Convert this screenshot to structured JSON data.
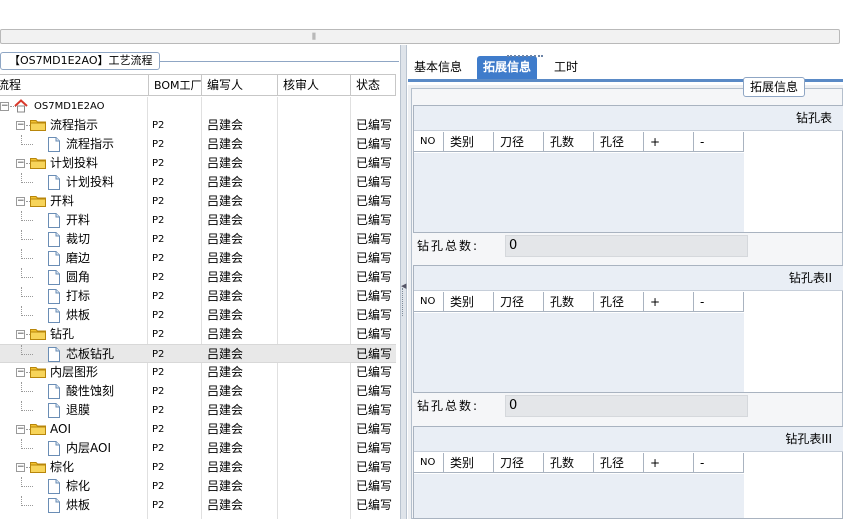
{
  "topbar": {
    "scroll_grip": "⫼"
  },
  "left_panel": {
    "group_title": "【OS7MD1E2AO】工艺流程",
    "columns": [
      "流程",
      "BOM工厂",
      "编写人",
      "核审人",
      "状态"
    ],
    "rows": [
      {
        "name": "OS7MD1E2AO",
        "icon": "home-icon",
        "level": 0,
        "expand": "minus",
        "bom": "",
        "author": "",
        "reviewer": "",
        "status": ""
      },
      {
        "name": "流程指示",
        "icon": "folder-icon",
        "level": 1,
        "expand": "minus",
        "bom": "P2",
        "author": "吕建会",
        "reviewer": "",
        "status": "已编写"
      },
      {
        "name": "流程指示",
        "icon": "document-icon",
        "level": 2,
        "expand": "",
        "bom": "P2",
        "author": "吕建会",
        "reviewer": "",
        "status": "已编写"
      },
      {
        "name": "计划投料",
        "icon": "folder-icon",
        "level": 1,
        "expand": "minus",
        "bom": "P2",
        "author": "吕建会",
        "reviewer": "",
        "status": "已编写"
      },
      {
        "name": "计划投料",
        "icon": "document-icon",
        "level": 2,
        "expand": "",
        "bom": "P2",
        "author": "吕建会",
        "reviewer": "",
        "status": "已编写"
      },
      {
        "name": "开料",
        "icon": "folder-icon",
        "level": 1,
        "expand": "minus",
        "bom": "P2",
        "author": "吕建会",
        "reviewer": "",
        "status": "已编写"
      },
      {
        "name": "开料",
        "icon": "document-icon",
        "level": 2,
        "expand": "",
        "bom": "P2",
        "author": "吕建会",
        "reviewer": "",
        "status": "已编写"
      },
      {
        "name": "裁切",
        "icon": "document-icon",
        "level": 2,
        "expand": "",
        "bom": "P2",
        "author": "吕建会",
        "reviewer": "",
        "status": "已编写"
      },
      {
        "name": "磨边",
        "icon": "document-icon",
        "level": 2,
        "expand": "",
        "bom": "P2",
        "author": "吕建会",
        "reviewer": "",
        "status": "已编写"
      },
      {
        "name": "圆角",
        "icon": "document-icon",
        "level": 2,
        "expand": "",
        "bom": "P2",
        "author": "吕建会",
        "reviewer": "",
        "status": "已编写"
      },
      {
        "name": "打标",
        "icon": "document-icon",
        "level": 2,
        "expand": "",
        "bom": "P2",
        "author": "吕建会",
        "reviewer": "",
        "status": "已编写"
      },
      {
        "name": "烘板",
        "icon": "document-icon",
        "level": 2,
        "expand": "",
        "bom": "P2",
        "author": "吕建会",
        "reviewer": "",
        "status": "已编写"
      },
      {
        "name": "钻孔",
        "icon": "folder-icon",
        "level": 1,
        "expand": "minus",
        "bom": "P2",
        "author": "吕建会",
        "reviewer": "",
        "status": "已编写"
      },
      {
        "name": "芯板钻孔",
        "icon": "document-icon",
        "level": 2,
        "expand": "",
        "bom": "P2",
        "author": "吕建会",
        "reviewer": "",
        "status": "已编写",
        "selected": true
      },
      {
        "name": "内层图形",
        "icon": "folder-icon",
        "level": 1,
        "expand": "minus",
        "bom": "P2",
        "author": "吕建会",
        "reviewer": "",
        "status": "已编写"
      },
      {
        "name": "酸性蚀刻",
        "icon": "document-icon",
        "level": 2,
        "expand": "",
        "bom": "P2",
        "author": "吕建会",
        "reviewer": "",
        "status": "已编写"
      },
      {
        "name": "退膜",
        "icon": "document-icon",
        "level": 2,
        "expand": "",
        "bom": "P2",
        "author": "吕建会",
        "reviewer": "",
        "status": "已编写"
      },
      {
        "name": "AOI",
        "icon": "folder-icon",
        "level": 1,
        "expand": "minus",
        "bom": "P2",
        "author": "吕建会",
        "reviewer": "",
        "status": "已编写"
      },
      {
        "name": "内层AOI",
        "icon": "document-icon",
        "level": 2,
        "expand": "",
        "bom": "P2",
        "author": "吕建会",
        "reviewer": "",
        "status": "已编写"
      },
      {
        "name": "棕化",
        "icon": "folder-icon",
        "level": 1,
        "expand": "minus",
        "bom": "P2",
        "author": "吕建会",
        "reviewer": "",
        "status": "已编写"
      },
      {
        "name": "棕化",
        "icon": "document-icon",
        "level": 2,
        "expand": "",
        "bom": "P2",
        "author": "吕建会",
        "reviewer": "",
        "status": "已编写"
      },
      {
        "name": "烘板",
        "icon": "document-icon",
        "level": 2,
        "expand": "",
        "bom": "P2",
        "author": "吕建会",
        "reviewer": "",
        "status": "已编写"
      }
    ]
  },
  "right_panel": {
    "tabs": [
      {
        "label": "基本信息",
        "active": false
      },
      {
        "label": "拓展信息",
        "active": true
      },
      {
        "label": "工时",
        "active": false
      }
    ],
    "section_title": "拓展信息",
    "drill_columns": [
      "NO",
      "类别",
      "刀径",
      "孔数",
      "孔径",
      "+",
      "-"
    ],
    "drill_tables": [
      {
        "title": "钻孔表",
        "total_label": "钻孔总数:",
        "total_value": "0"
      },
      {
        "title": "钻孔表II",
        "total_label": "钻孔总数:",
        "total_value": "0"
      },
      {
        "title": "钻孔表III"
      }
    ]
  },
  "colors": {
    "tab_active": "#3f7ccb",
    "tab_underline": "#5a8ac6",
    "folder": "#f2c230",
    "home_roof": "#d9392b"
  }
}
